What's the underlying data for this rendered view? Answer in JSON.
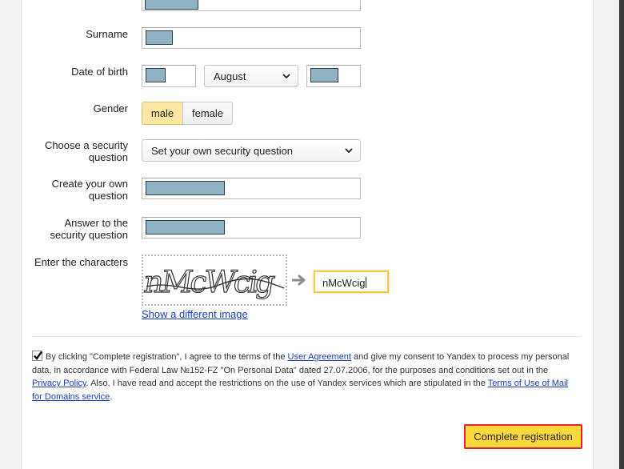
{
  "form": {
    "surname_label": "Surname",
    "dob_label": "Date of birth",
    "dob_month": "August",
    "gender_label": "Gender",
    "gender_options": [
      "male",
      "female"
    ],
    "gender_selected": "male",
    "security_question_label": "Choose a security question",
    "security_question_value": "Set your own security question",
    "own_question_label": "Create your own question",
    "answer_label": "Answer to the security question",
    "captcha_label": "Enter the characters",
    "captcha_image_text": "nMcWcig",
    "captcha_input_value": "nMcWcig",
    "show_different_image": "Show a different image"
  },
  "agreement": {
    "checked": true,
    "text_1": "By clicking \"Complete registration\", I agree to the terms of the ",
    "user_agreement_link": "User Agreement",
    "text_2": " and give my consent to Yandex to process my personal data, in accordance with Federal Law №152-FZ \"On Personal Data\" dated 27.07.2006, for the purposes and conditions set out in the ",
    "privacy_policy_link": "Privacy Policy",
    "text_3": ". Also, I have read and accept the restrictions on the use of Yandex services which are stipulated in the ",
    "terms_link": "Terms of Use of Mail for Domains service",
    "text_4": "."
  },
  "submit_label": "Complete registration",
  "colors": {
    "accent_yellow": "#fdd83a",
    "highlight_red": "#e8242a",
    "link_blue": "#1a3dc1",
    "redaction": "#8fb3c2"
  }
}
